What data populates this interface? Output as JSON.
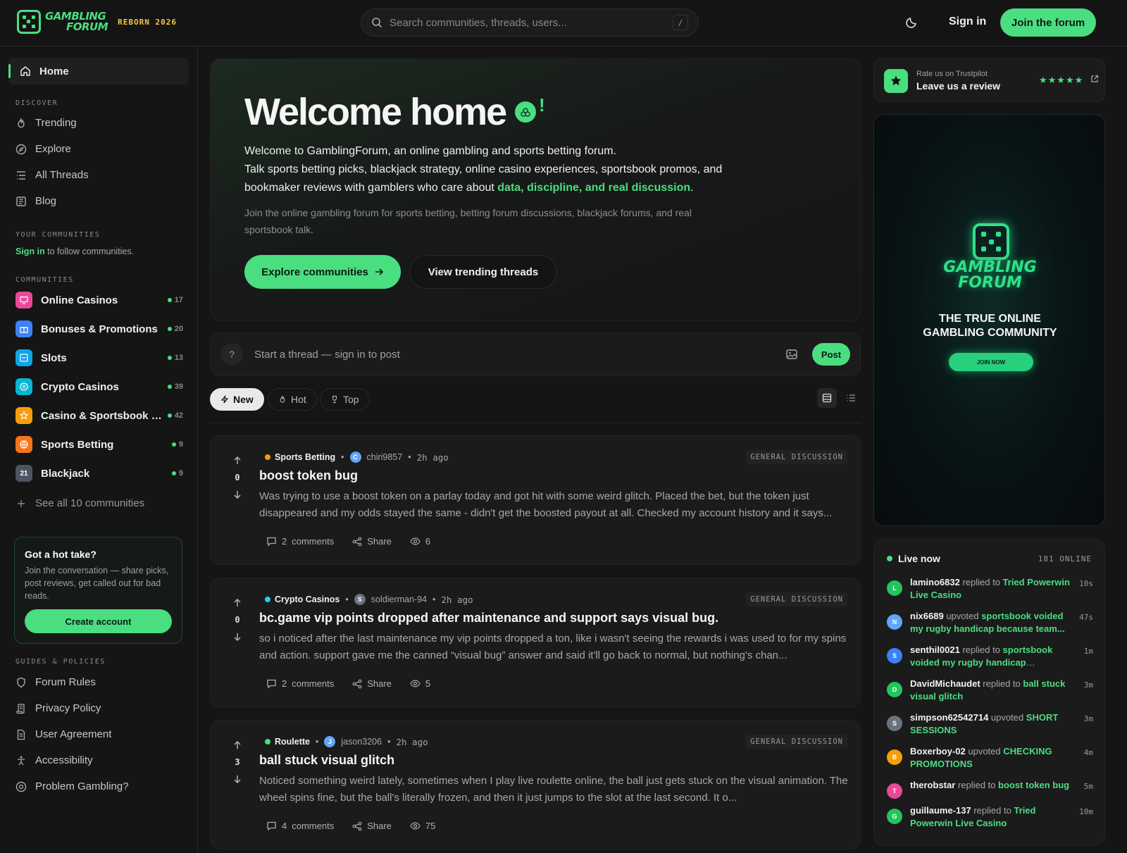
{
  "header": {
    "logo_line1": "GAMBLING",
    "logo_line2": "FORUM",
    "logo_tag": "REBORN 2026",
    "search_placeholder": "Search communities, threads, users...",
    "search_shortcut": "/",
    "signin": "Sign in",
    "join": "Join the forum",
    "accent": "#4ade80"
  },
  "sidebar": {
    "home": "Home",
    "discover_label": "DISCOVER",
    "discover": [
      "Trending",
      "Explore",
      "All Threads",
      "Blog"
    ],
    "your_comm_label": "YOUR COMMUNITIES",
    "signin_link": "Sign in",
    "signin_rest": " to follow communities.",
    "communities_label": "COMMUNITIES",
    "communities": [
      {
        "name": "Online Casinos",
        "count": "17",
        "color": "#ec4899"
      },
      {
        "name": "Bonuses & Promotions",
        "count": "20",
        "color": "#3b82f6"
      },
      {
        "name": "Slots",
        "count": "13",
        "color": "#0ea5e9"
      },
      {
        "name": "Crypto Casinos",
        "count": "39",
        "color": "#06b6d4"
      },
      {
        "name": "Casino & Sportsbook R...",
        "count": "42",
        "color": "#f59e0b"
      },
      {
        "name": "Sports Betting",
        "count": "9",
        "color": "#f97316"
      },
      {
        "name": "Blackjack",
        "count": "9",
        "color": "#4b5563",
        "glyph": "21"
      }
    ],
    "see_all": "See all 10 communities",
    "hot_take": {
      "title": "Got a hot take?",
      "body": "Join the conversation — share picks, post reviews, get called out for bad reads.",
      "button": "Create account"
    },
    "guides_label": "GUIDES & POLICIES",
    "guides": [
      "Forum Rules",
      "Privacy Policy",
      "User Agreement",
      "Accessibility",
      "Problem Gambling?"
    ]
  },
  "hero": {
    "title": "Welcome home",
    "line1": "Welcome to GamblingForum, an online gambling and sports betting forum.",
    "line2": "Talk sports betting picks, blackjack strategy, online casino experiences, sportsbook promos, and bookmaker reviews with gamblers who care about ",
    "highlight": "data, discipline, and real discussion",
    "period": ".",
    "sub": "Join the online gambling forum for sports betting, betting forum discussions, blackjack forums, and real sportsbook talk.",
    "btn_primary": "Explore communities",
    "btn_secondary": "View trending threads"
  },
  "composer": {
    "placeholder": "Start a thread — sign in to post",
    "post": "Post"
  },
  "filters": {
    "new": "New",
    "hot": "Hot",
    "top": "Top"
  },
  "threads": [
    {
      "community": "Sports Betting",
      "dot": "#f59e0b",
      "avatar": "C",
      "avatar_color": "#60a5fa",
      "user": "chiri9857",
      "time": "2h ago",
      "tag": "GENERAL DISCUSSION",
      "votes": "0",
      "title": "boost token bug",
      "excerpt": "Was trying to use a boost token on a parlay today and got hit with some weird glitch. Placed the bet, but the token just disappeared and my odds stayed the same - didn't get the boosted payout at all. Checked my account history and it says...",
      "comments": "2",
      "comments_label": "comments",
      "share": "Share",
      "views": "6"
    },
    {
      "community": "Crypto Casinos",
      "dot": "#22d3ee",
      "avatar": "S",
      "avatar_color": "#6b7280",
      "user": "soldierman-94",
      "time": "2h ago",
      "tag": "GENERAL DISCUSSION",
      "votes": "0",
      "title": "bc.game vip points dropped after maintenance and support says visual bug.",
      "excerpt": "so i noticed after the last maintenance my vip points dropped a ton, like i wasn't seeing the rewards i was used to for my spins and action. support gave me the canned “visual bug” answer and said it'll go back to normal, but nothing's chan...",
      "comments": "2",
      "comments_label": "comments",
      "share": "Share",
      "views": "5"
    },
    {
      "community": "Roulette",
      "dot": "#4ade80",
      "avatar": "J",
      "avatar_color": "#60a5fa",
      "user": "jason3206",
      "time": "2h ago",
      "tag": "GENERAL DISCUSSION",
      "votes": "3",
      "title": "ball stuck visual glitch",
      "excerpt": "Noticed something weird lately, sometimes when I play live roulette online, the ball just gets stuck on the visual animation. The wheel spins fine, but the ball's literally frozen, and then it just jumps to the slot at the last second. It o...",
      "comments": "4",
      "comments_label": "comments",
      "share": "Share",
      "views": "75"
    }
  ],
  "trustpilot": {
    "line1": "Rate us on Trustpilot",
    "line2": "Leave us a review",
    "stars": "★★★★★"
  },
  "ad": {
    "brand1": "GAMBLING",
    "brand2": "FORUM",
    "tagline1": "THE TRUE ONLINE",
    "tagline2": "GAMBLING COMMUNITY",
    "button": "JOIN NOW"
  },
  "live": {
    "title": "Live now",
    "online": "181 ONLINE",
    "events": [
      {
        "user": "lamino6832",
        "action": " replied to ",
        "target": "Tried Powerwin Live Casino",
        "time": "10s",
        "avatar": "L",
        "color": "#22c55e"
      },
      {
        "user": "nix6689",
        "action": " upvoted ",
        "target": "sportsbook voided my rugby handicap because team...",
        "time": "47s",
        "avatar": "N",
        "color": "#60a5fa"
      },
      {
        "user": "senthil0021",
        "action": " replied to ",
        "target": "sportsbook voided my rugby handicap because...",
        "time": "1m",
        "avatar": "S",
        "color": "#3b82f6"
      },
      {
        "user": "DavidMichaudet",
        "action": " replied to ",
        "target": "ball stuck visual glitch",
        "time": "3m",
        "avatar": "D",
        "color": "#22c55e"
      },
      {
        "user": "simpson62542714",
        "action": " upvoted ",
        "target": "SHORT SESSIONS",
        "time": "3m",
        "avatar": "S",
        "color": "#6b7280"
      },
      {
        "user": "Boxerboy-02",
        "action": " upvoted ",
        "target": "CHECKING PROMOTIONS",
        "time": "4m",
        "avatar": "B",
        "color": "#f59e0b"
      },
      {
        "user": "therobstar",
        "action": " replied to ",
        "target": "boost token bug",
        "time": "5m",
        "avatar": "T",
        "color": "#ec4899"
      },
      {
        "user": "guillaume-137",
        "action": " replied to ",
        "target": "Tried Powerwin Live Casino",
        "time": "10m",
        "avatar": "G",
        "color": "#22c55e"
      }
    ]
  }
}
